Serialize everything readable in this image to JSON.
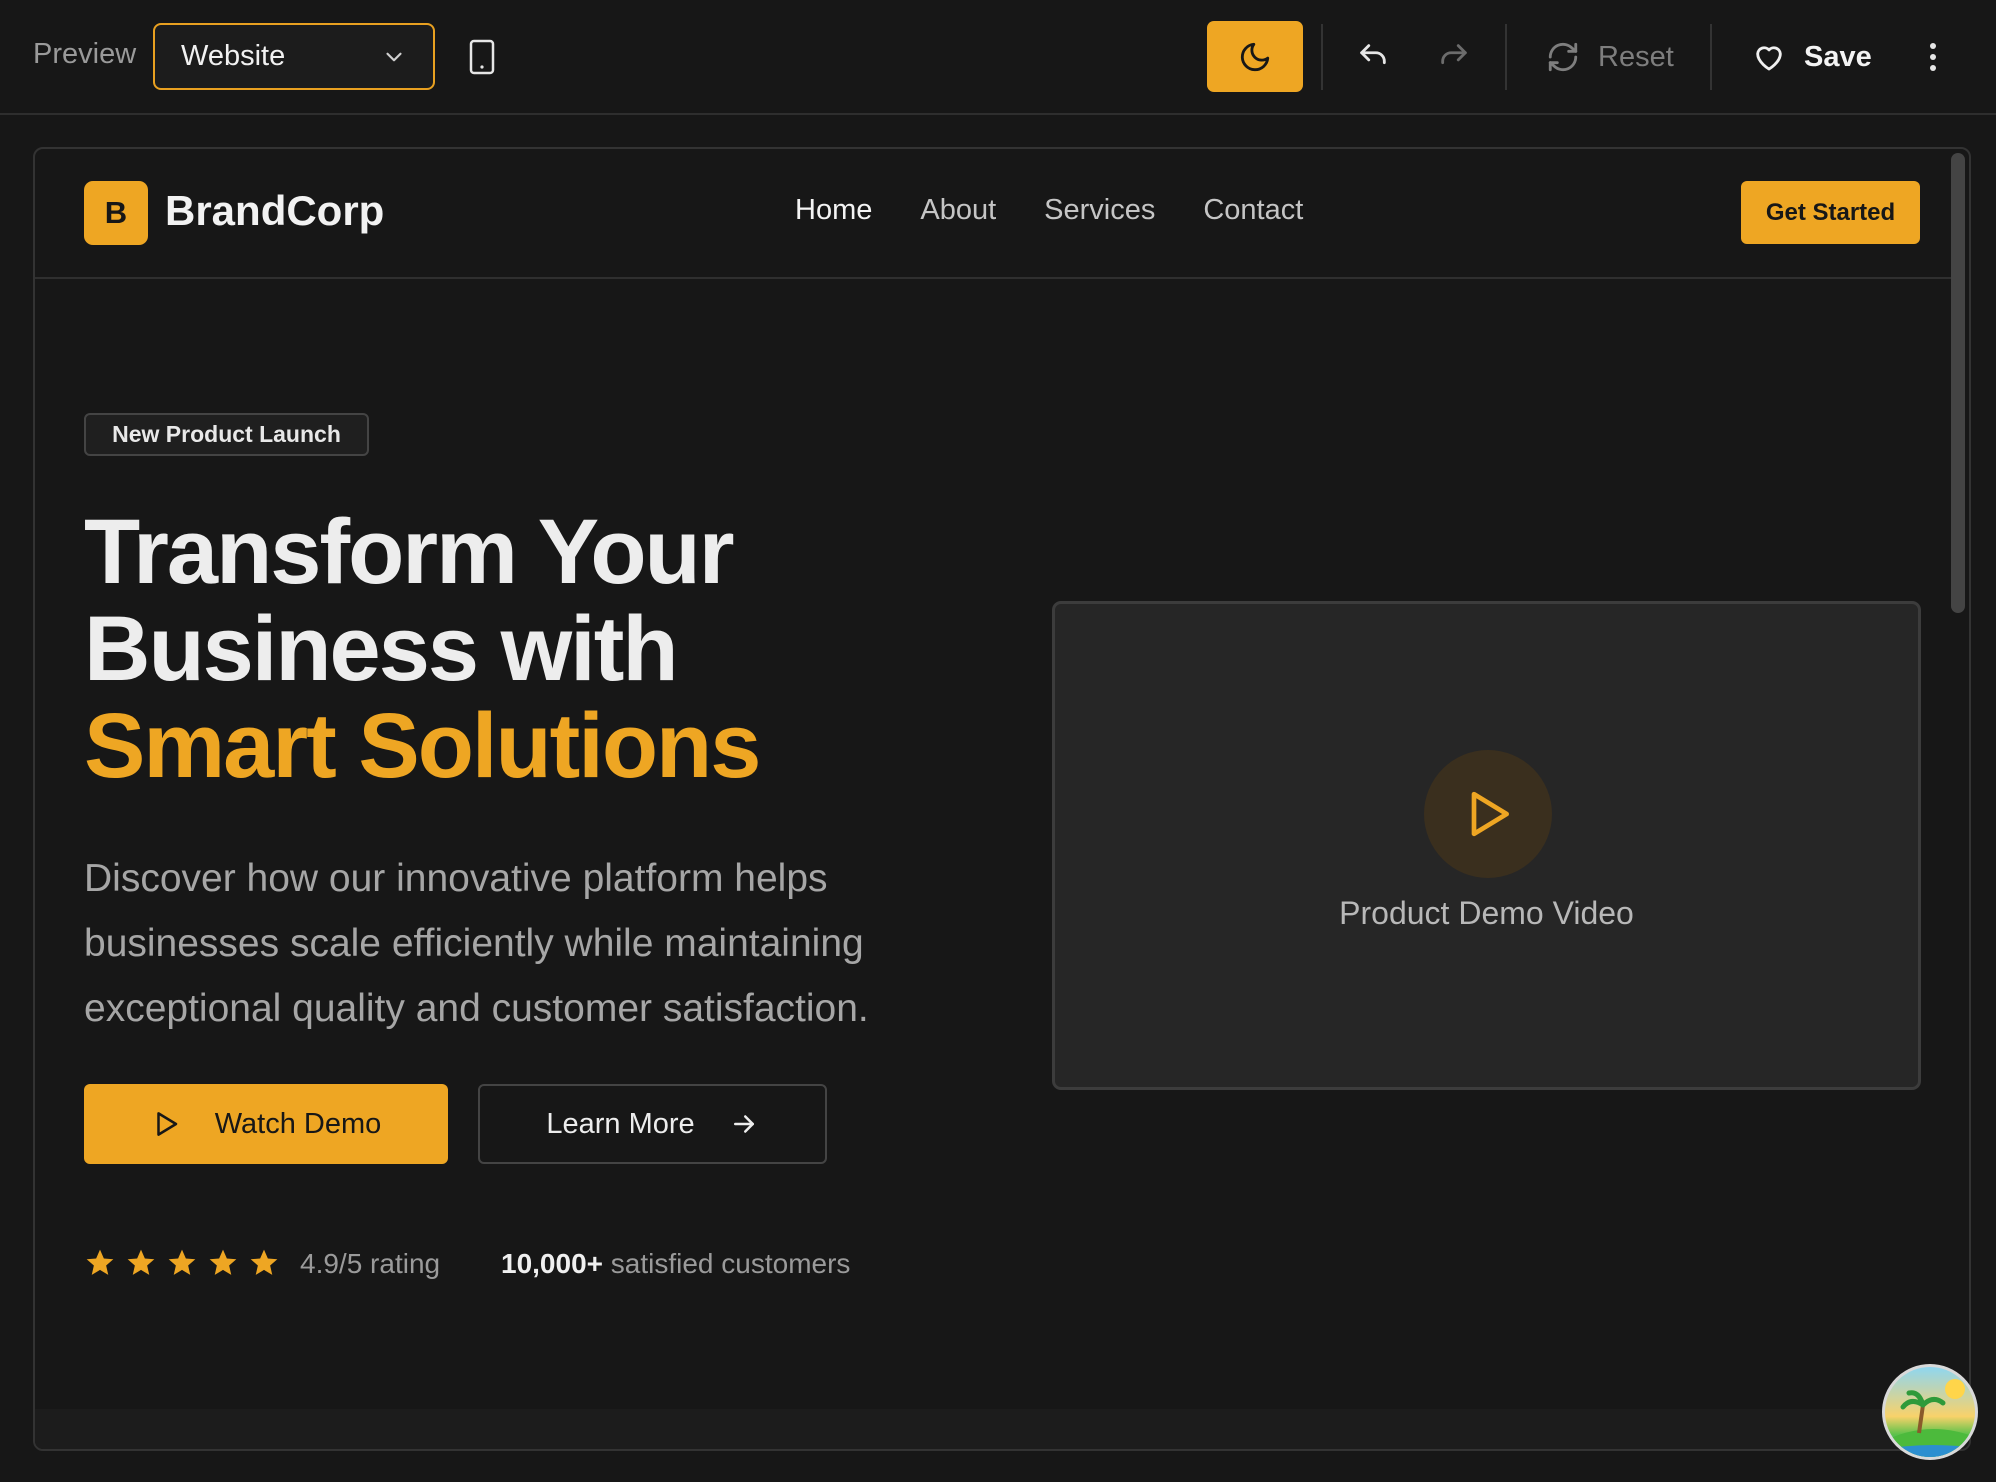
{
  "toolbar": {
    "preview_label": "Preview",
    "view_select": {
      "selected": "Website"
    },
    "reset_label": "Reset",
    "save_label": "Save"
  },
  "site": {
    "brand": {
      "logo_letter": "B",
      "name": "BrandCorp"
    },
    "nav": [
      {
        "label": "Home",
        "active": true
      },
      {
        "label": "About",
        "active": false
      },
      {
        "label": "Services",
        "active": false
      },
      {
        "label": "Contact",
        "active": false
      }
    ],
    "cta_label": "Get Started",
    "hero": {
      "badge": "New Product Launch",
      "title_line1": "Transform Your",
      "title_line2": "Business with",
      "title_accent": "Smart Solutions",
      "subtitle": "Discover how our innovative platform helps businesses scale efficiently while maintaining exceptional quality and customer satisfaction.",
      "primary_button": "Watch Demo",
      "secondary_button": "Learn More",
      "rating_stars": 5,
      "rating_text": "4.9/5 rating",
      "customers_count": "10,000+",
      "customers_text": "satisfied customers"
    },
    "video": {
      "label": "Product Demo Video"
    }
  },
  "colors": {
    "accent": "#eea623",
    "background": "#171717",
    "card": "#262626"
  },
  "icons": [
    "chevron-down-icon",
    "mobile-icon",
    "moon-icon",
    "undo-icon",
    "redo-icon",
    "refresh-icon",
    "heart-icon",
    "more-vertical-icon",
    "play-icon",
    "arrow-right-icon",
    "star-icon"
  ]
}
